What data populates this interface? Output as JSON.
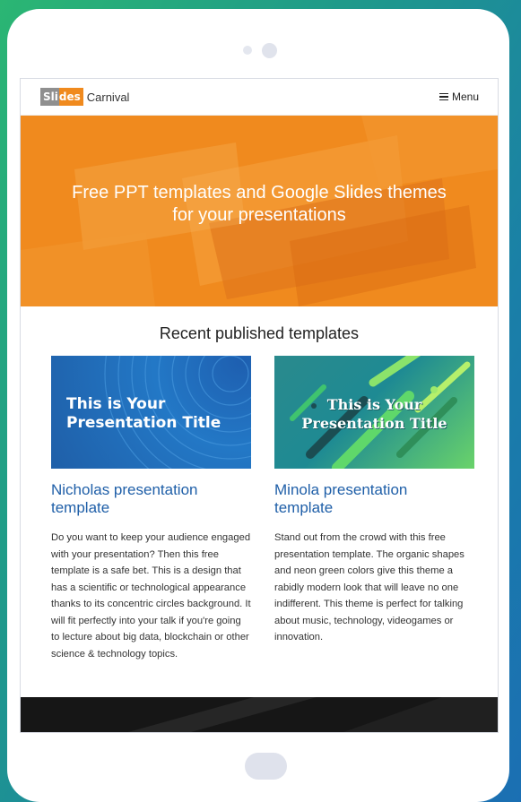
{
  "nav": {
    "logo_slides_a": "Sli",
    "logo_slides_b": "des",
    "logo_carnival": "Carnival",
    "menu_label": "Menu"
  },
  "hero": {
    "title_line1": "Free PPT templates and Google Slides themes",
    "title_line2": "for your presentations",
    "bg_color": "#f08a1e"
  },
  "section": {
    "title": "Recent published templates"
  },
  "cards": [
    {
      "thumb_title_line1": "This is Your",
      "thumb_title_line2": "Presentation Title",
      "title_line1": "Nicholas presentation",
      "title_line2": "template",
      "description": "Do you want to keep your audience engaged with your presentation? Then this free template is a safe bet. This is a design that has a scientific or technological appearance thanks to its concentric circles background. It will fit perfectly into your talk if you're going to lecture about big data, blockchain or other science & technology topics."
    },
    {
      "thumb_title_line1": "This is Your",
      "thumb_title_line2": "Presentation Title",
      "title_line1": "Minola presentation",
      "title_line2": "template",
      "description": "Stand out from the crowd with this free presentation template. The organic shapes and neon green colors give this theme a rabidly modern look that will leave no one indifferent. This theme is perfect for talking about music, technology, videogames or innovation."
    }
  ],
  "colors": {
    "accent": "#f08a1e",
    "link": "#1f5fa8"
  }
}
